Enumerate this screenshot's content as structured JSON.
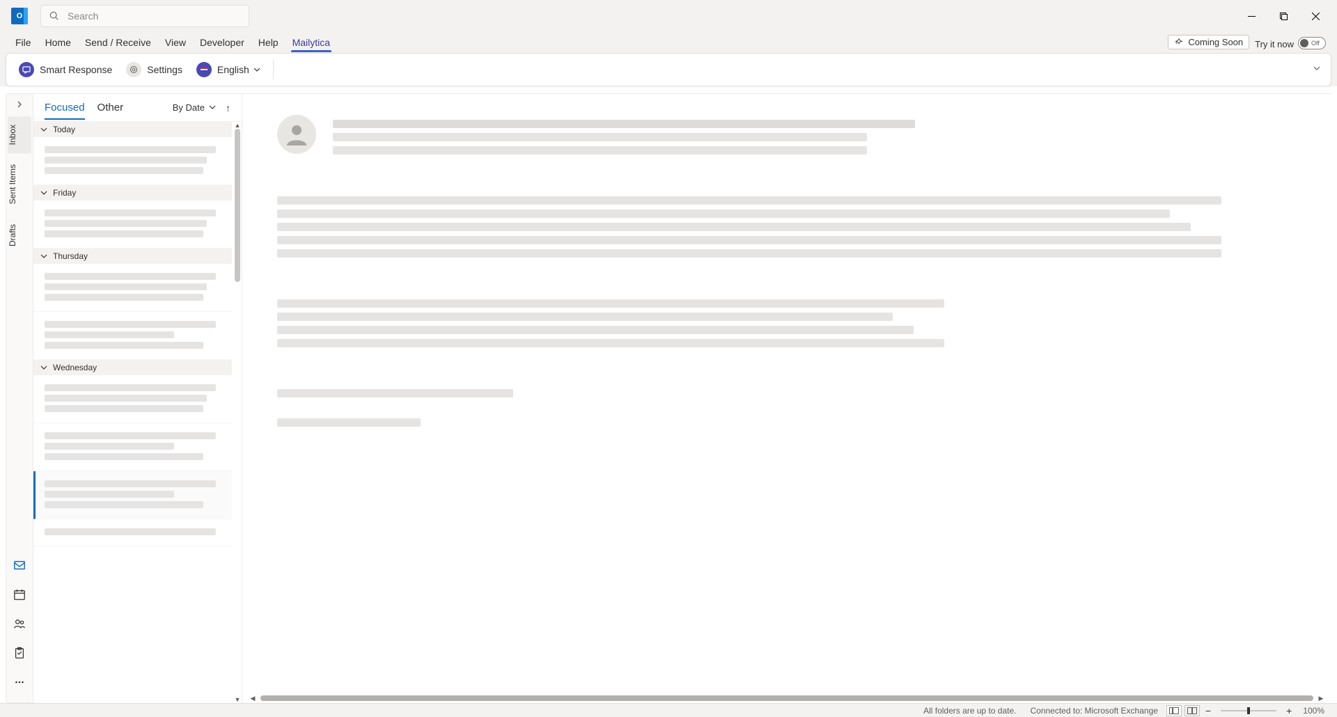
{
  "app": {
    "name": "Outlook",
    "icon_letter": "O",
    "search_placeholder": "Search"
  },
  "window_controls": {
    "minimize": "minimize",
    "maximize": "maximize",
    "close": "close"
  },
  "menu": {
    "items": [
      "File",
      "Home",
      "Send / Receive",
      "View",
      "Developer",
      "Help",
      "Mailytica"
    ],
    "active_index": 6,
    "coming_soon_label": "Coming Soon",
    "try_it_label": "Try it now",
    "toggle_label": "Off",
    "toggle_state": false
  },
  "ribbon": {
    "buttons": [
      {
        "id": "smart-response",
        "label": "Smart Response",
        "variant": "purple"
      },
      {
        "id": "settings",
        "label": "Settings",
        "variant": "grey"
      },
      {
        "id": "english",
        "label": "English",
        "variant": "purple",
        "has_dropdown": true
      }
    ]
  },
  "nav": {
    "vertical_tabs": [
      "Inbox",
      "Sent Items",
      "Drafts"
    ],
    "active_tab_index": 0,
    "apps": [
      {
        "id": "mail",
        "name": "mail-icon"
      },
      {
        "id": "calendar",
        "name": "calendar-icon"
      },
      {
        "id": "people",
        "name": "people-icon"
      },
      {
        "id": "tasks",
        "name": "tasks-icon"
      },
      {
        "id": "more",
        "name": "more-icon"
      }
    ]
  },
  "message_list": {
    "tabs": {
      "focused": "Focused",
      "other": "Other",
      "active": "focused"
    },
    "sort_label": "By Date",
    "sort_direction": "ascending",
    "groups": [
      "Today",
      "Friday",
      "Thursday",
      "Wednesday"
    ]
  },
  "status": {
    "sync": "All folders are up to date.",
    "connection": "Connected to: Microsoft Exchange",
    "zoom": "100%"
  }
}
